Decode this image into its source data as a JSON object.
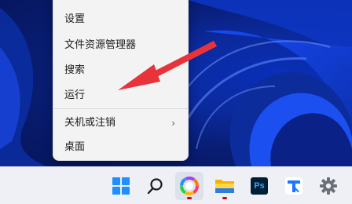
{
  "context_menu": {
    "items": [
      {
        "label": "设置"
      },
      {
        "label": "文件资源管理器"
      },
      {
        "label": "搜索"
      },
      {
        "label": "运行"
      },
      {
        "label": "关机或注销",
        "has_submenu": true
      },
      {
        "label": "桌面"
      }
    ],
    "submenu_glyph": "›"
  },
  "taskbar": {
    "icons": [
      {
        "name": "start-icon"
      },
      {
        "name": "search-icon"
      },
      {
        "name": "colorful-app-icon",
        "running": true
      },
      {
        "name": "file-explorer-icon",
        "running": true
      },
      {
        "name": "photoshop-icon",
        "label": "Ps"
      },
      {
        "name": "blue-t-app-icon"
      },
      {
        "name": "settings-gear-icon"
      }
    ]
  },
  "colors": {
    "annotation_arrow": "#e8333b",
    "menu_bg": "#f3f3f3",
    "taskbar_bg": "#eef0f6",
    "running_indicator": "#d0021b"
  }
}
